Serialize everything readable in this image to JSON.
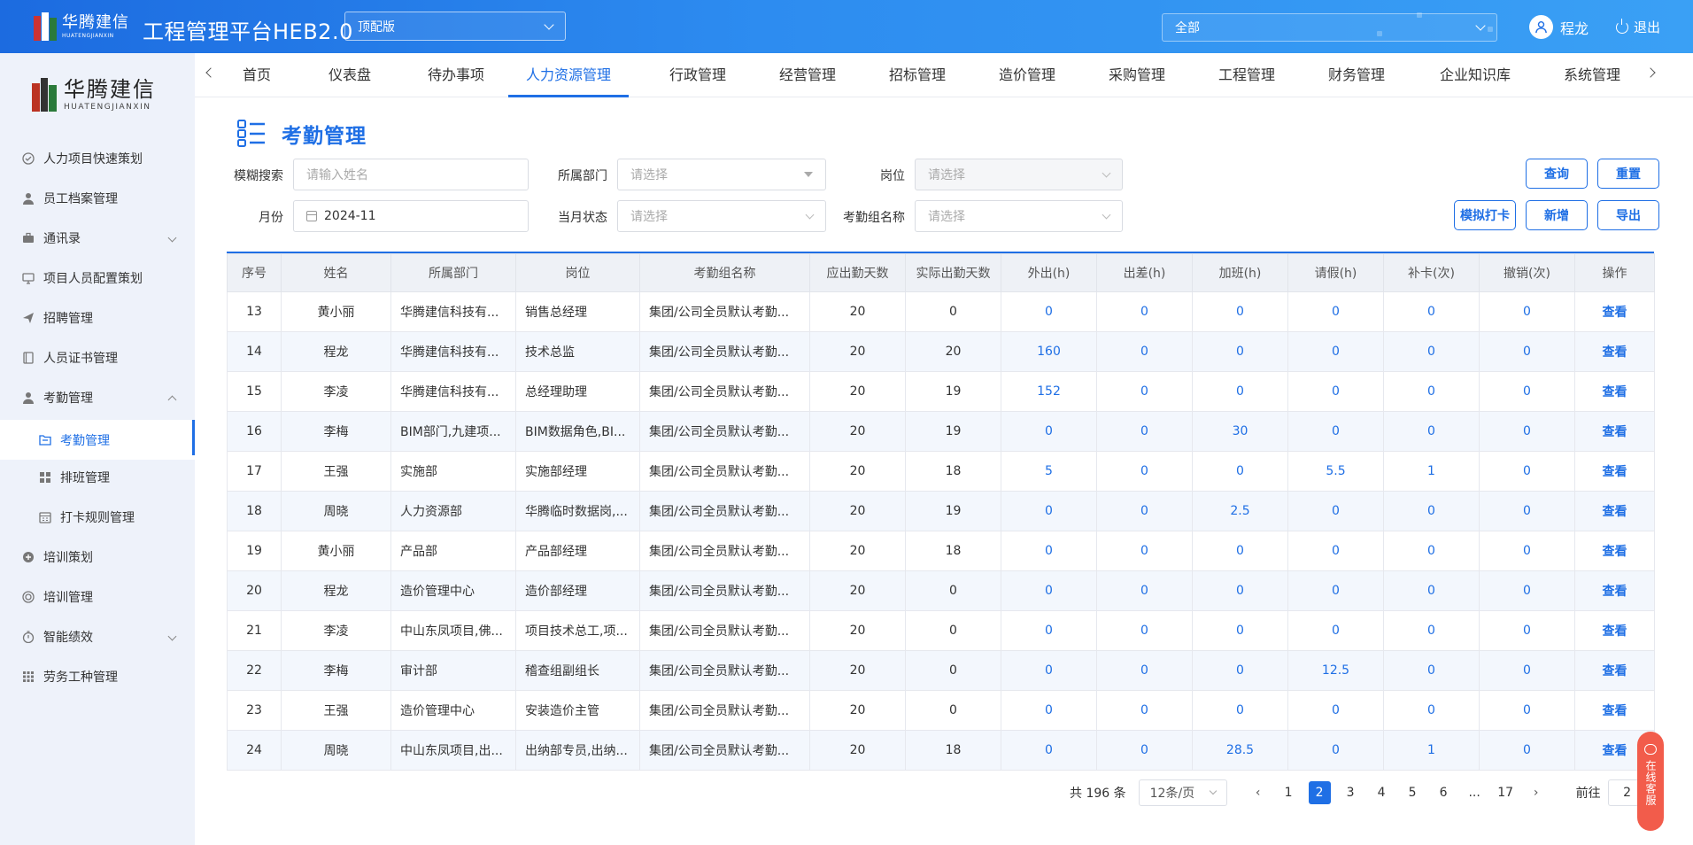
{
  "header": {
    "logo_cn": "华腾建信",
    "logo_en": "HUATENGJIANXIN",
    "app_title": "工程管理平台HEB2.0",
    "edition": "顶配版",
    "scope": "全部",
    "user_name": "程龙",
    "logout": "退出"
  },
  "sidebar": {
    "logo_cn": "华腾建信",
    "logo_en": "HUATENGJIANXIN",
    "items": [
      {
        "label": "人力项目快速策划",
        "icon": "check-circle-icon"
      },
      {
        "label": "员工档案管理",
        "icon": "user-icon"
      },
      {
        "label": "通讯录",
        "icon": "briefcase-icon"
      },
      {
        "label": "项目人员配置策划",
        "icon": "monitor-icon"
      },
      {
        "label": "招聘管理",
        "icon": "send-icon"
      },
      {
        "label": "人员证书管理",
        "icon": "certificate-icon"
      },
      {
        "label": "考勤管理",
        "icon": "user-icon"
      },
      {
        "label": "考勤管理",
        "icon": "folder-icon"
      },
      {
        "label": "排班管理",
        "icon": "grid-icon"
      },
      {
        "label": "打卡规则管理",
        "icon": "calendar-icon"
      },
      {
        "label": "培训策划",
        "icon": "plus-circle-icon"
      },
      {
        "label": "培训管理",
        "icon": "target-icon"
      },
      {
        "label": "智能绩效",
        "icon": "timer-icon"
      },
      {
        "label": "劳务工种管理",
        "icon": "apps-icon"
      }
    ]
  },
  "tabs": [
    "首页",
    "仪表盘",
    "待办事项",
    "人力资源管理",
    "行政管理",
    "经营管理",
    "招标管理",
    "造价管理",
    "采购管理",
    "工程管理",
    "财务管理",
    "企业知识库",
    "系统管理"
  ],
  "active_tab": "人力资源管理",
  "page": {
    "title": "考勤管理"
  },
  "filters": {
    "fuzzy_label": "模糊搜索",
    "fuzzy_placeholder": "请输入姓名",
    "dept_label": "所属部门",
    "dept_placeholder": "请选择",
    "post_label": "岗位",
    "post_placeholder": "请选择",
    "month_label": "月份",
    "month_value": "2024-11",
    "status_label": "当月状态",
    "status_placeholder": "请选择",
    "group_label": "考勤组名称",
    "group_placeholder": "请选择"
  },
  "buttons": {
    "query": "查询",
    "reset": "重置",
    "simulate": "模拟打卡",
    "add": "新增",
    "export": "导出"
  },
  "table": {
    "columns": [
      "序号",
      "姓名",
      "所属部门",
      "岗位",
      "考勤组名称",
      "应出勤天数",
      "实际出勤天数",
      "外出(h)",
      "出差(h)",
      "加班(h)",
      "请假(h)",
      "补卡(次)",
      "撤销(次)",
      "操作"
    ],
    "rows": [
      [
        "13",
        "黄小丽",
        "华腾建信科技有...",
        "销售总经理",
        "集团/公司全员默认考勤...",
        "20",
        "0",
        "0",
        "0",
        "0",
        "0",
        "0",
        "0",
        "查看"
      ],
      [
        "14",
        "程龙",
        "华腾建信科技有...",
        "技术总监",
        "集团/公司全员默认考勤...",
        "20",
        "20",
        "160",
        "0",
        "0",
        "0",
        "0",
        "0",
        "查看"
      ],
      [
        "15",
        "李凌",
        "华腾建信科技有...",
        "总经理助理",
        "集团/公司全员默认考勤...",
        "20",
        "19",
        "152",
        "0",
        "0",
        "0",
        "0",
        "0",
        "查看"
      ],
      [
        "16",
        "李梅",
        "BIM部门,九建项...",
        "BIM数据角色,BI...",
        "集团/公司全员默认考勤...",
        "20",
        "19",
        "0",
        "0",
        "30",
        "0",
        "0",
        "0",
        "查看"
      ],
      [
        "17",
        "王强",
        "实施部",
        "实施部经理",
        "集团/公司全员默认考勤...",
        "20",
        "18",
        "5",
        "0",
        "0",
        "5.5",
        "1",
        "0",
        "查看"
      ],
      [
        "18",
        "周晓",
        "人力资源部",
        "华腾临时数据岗,...",
        "集团/公司全员默认考勤...",
        "20",
        "19",
        "0",
        "0",
        "2.5",
        "0",
        "0",
        "0",
        "查看"
      ],
      [
        "19",
        "黄小丽",
        "产品部",
        "产品部经理",
        "集团/公司全员默认考勤...",
        "20",
        "18",
        "0",
        "0",
        "0",
        "0",
        "0",
        "0",
        "查看"
      ],
      [
        "20",
        "程龙",
        "造价管理中心",
        "造价部经理",
        "集团/公司全员默认考勤...",
        "20",
        "0",
        "0",
        "0",
        "0",
        "0",
        "0",
        "0",
        "查看"
      ],
      [
        "21",
        "李凌",
        "中山东凤项目,佛...",
        "项目技术总工,项...",
        "集团/公司全员默认考勤...",
        "20",
        "0",
        "0",
        "0",
        "0",
        "0",
        "0",
        "0",
        "查看"
      ],
      [
        "22",
        "李梅",
        "审计部",
        "稽查组副组长",
        "集团/公司全员默认考勤...",
        "20",
        "0",
        "0",
        "0",
        "0",
        "12.5",
        "0",
        "0",
        "查看"
      ],
      [
        "23",
        "王强",
        "造价管理中心",
        "安装造价主管",
        "集团/公司全员默认考勤...",
        "20",
        "0",
        "0",
        "0",
        "0",
        "0",
        "0",
        "0",
        "查看"
      ],
      [
        "24",
        "周晓",
        "中山东凤项目,出...",
        "出纳部专员,出纳...",
        "集团/公司全员默认考勤...",
        "20",
        "18",
        "0",
        "0",
        "28.5",
        "0",
        "1",
        "0",
        "查看"
      ]
    ]
  },
  "pagination": {
    "total": "共 196 条",
    "page_size": "12条/页",
    "pages": [
      "1",
      "2",
      "3",
      "4",
      "5",
      "6",
      "...",
      "17"
    ],
    "current": "2",
    "goto_label": "前往",
    "goto_value": "2"
  },
  "service": {
    "label": "在线客服"
  },
  "colors": {
    "accent": "#1f6fe5",
    "header_start": "#1c6be0",
    "header_end": "#3aa0f5",
    "service": "#f25c4b"
  }
}
